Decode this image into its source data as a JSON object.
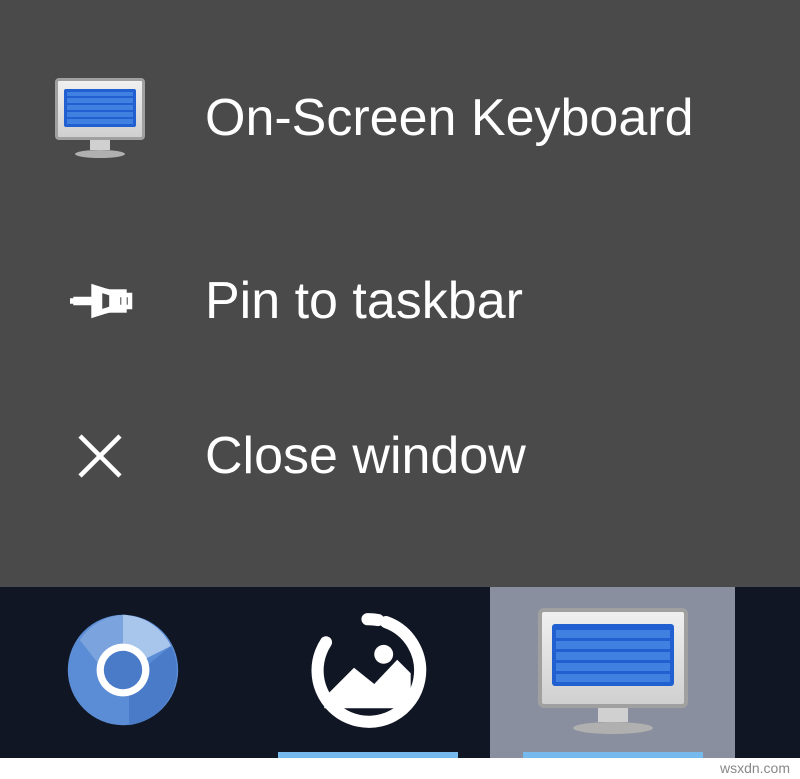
{
  "menu": {
    "items": [
      {
        "label": "On-Screen Keyboard",
        "icon": "osk"
      },
      {
        "label": "Pin to taskbar",
        "icon": "pin"
      },
      {
        "label": "Close window",
        "icon": "close"
      }
    ]
  },
  "taskbar": {
    "items": [
      {
        "name": "chromium",
        "active": false
      },
      {
        "name": "photos",
        "active": true
      },
      {
        "name": "on-screen-keyboard",
        "active": true,
        "selected": true
      }
    ]
  },
  "watermark": "wsxdn.com"
}
